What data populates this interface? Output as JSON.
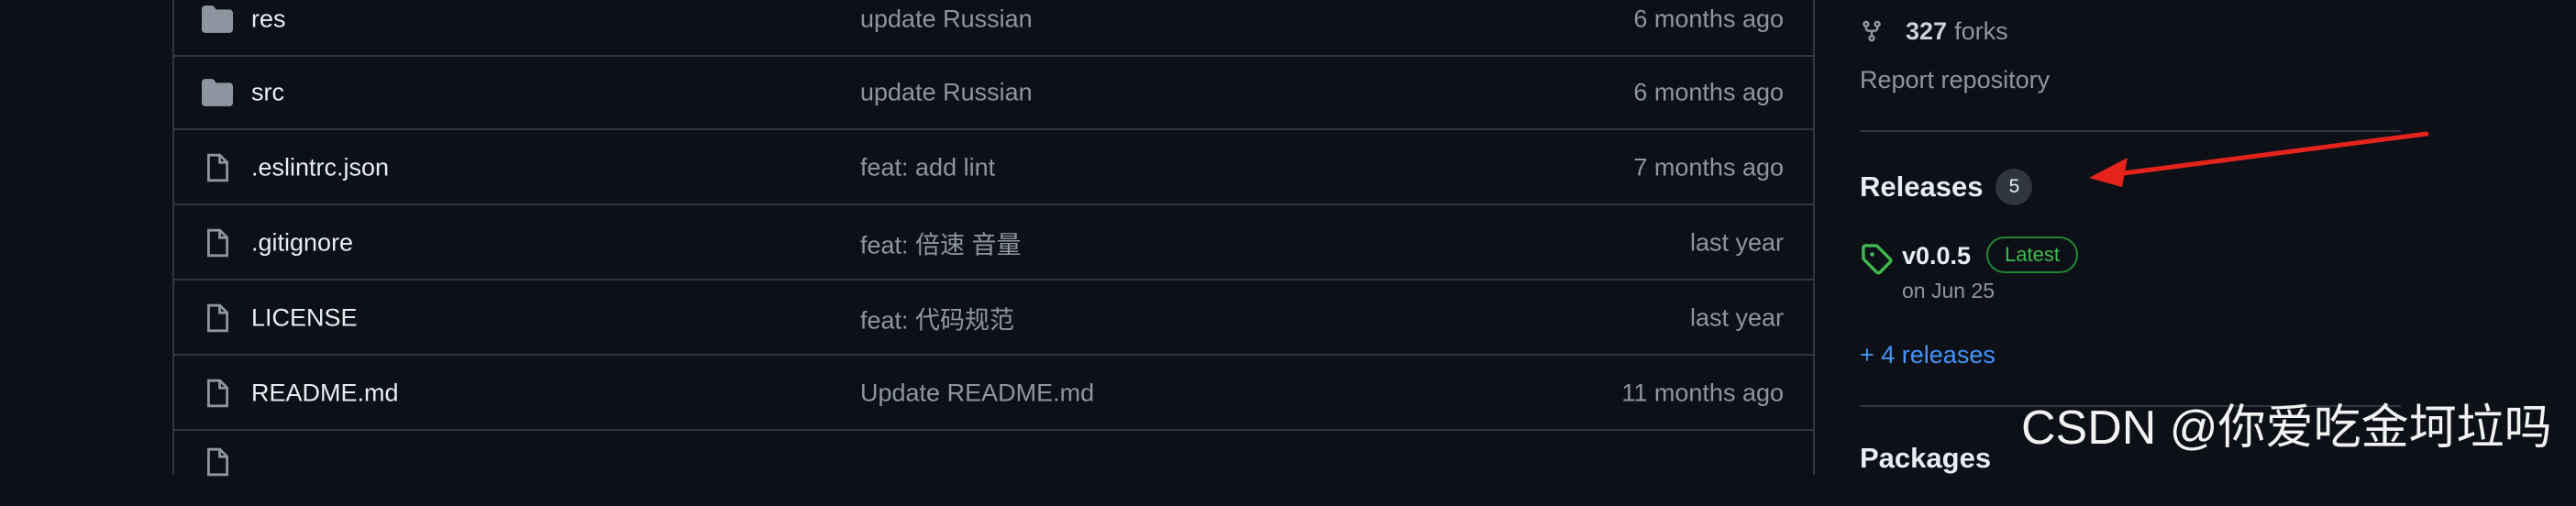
{
  "files": [
    {
      "type": "folder",
      "name": "res",
      "commit": "update Russian",
      "time": "6 months ago"
    },
    {
      "type": "folder",
      "name": "src",
      "commit": "update Russian",
      "time": "6 months ago"
    },
    {
      "type": "file",
      "name": ".eslintrc.json",
      "commit": "feat: add lint",
      "time": "7 months ago"
    },
    {
      "type": "file",
      "name": ".gitignore",
      "commit": "feat: 倍速 音量",
      "time": "last year"
    },
    {
      "type": "file",
      "name": "LICENSE",
      "commit": "feat: 代码规范",
      "time": "last year"
    },
    {
      "type": "file",
      "name": "README.md",
      "commit": "Update README.md",
      "time": "11 months ago"
    },
    {
      "type": "file",
      "name": "",
      "commit": "",
      "time": ""
    }
  ],
  "sidebar": {
    "forks_count": "327",
    "forks_label": "forks",
    "report": "Report repository",
    "releases": {
      "title": "Releases",
      "count": "5",
      "latest": {
        "version": "v0.0.5",
        "badge": "Latest",
        "date": "on Jun 25"
      },
      "more": "+ 4 releases"
    },
    "packages_title": "Packages"
  },
  "watermark": "CSDN @你爱吃金坷垃吗",
  "icons": {
    "folder": "folder-icon",
    "file": "file-icon",
    "fork": "fork-icon",
    "tag": "tag-icon"
  },
  "colors": {
    "background": "#0d1117",
    "border": "#30363d",
    "muted_text": "#8d96a0",
    "link": "#4493f8",
    "latest_green": "#3fb950",
    "annotation_arrow": "#e5231b"
  }
}
